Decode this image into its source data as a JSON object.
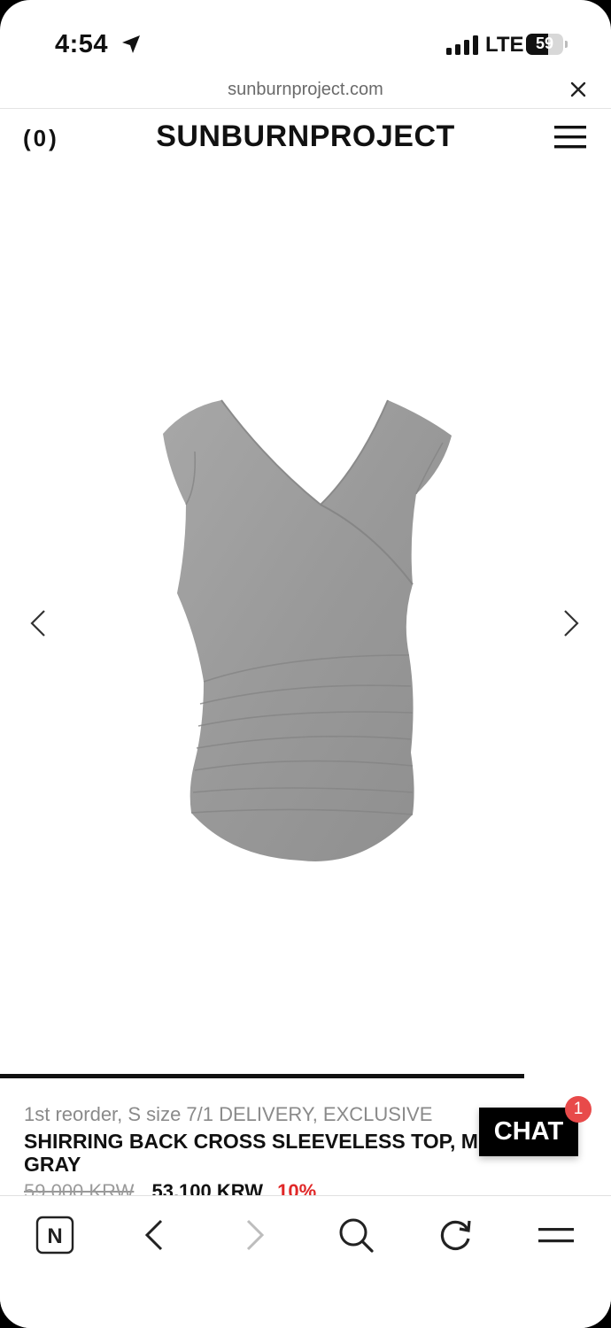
{
  "status_bar": {
    "time": "4:54",
    "network": "LTE",
    "battery_level": "59",
    "battery_fraction": 0.59,
    "icons": [
      "location-arrow-icon",
      "signal-bars-icon",
      "battery-icon"
    ]
  },
  "browser": {
    "url": "sunburnproject.com",
    "close_icon": "close-icon"
  },
  "header": {
    "cart_count": "(0)",
    "brand": "SUNBURNPROJECT",
    "menu_icon": "hamburger-menu-icon"
  },
  "product": {
    "image": "gray sleeveless shirred top",
    "prev_icon": "chevron-left-icon",
    "next_icon": "chevron-right-icon",
    "subtitle": "1st reorder, S size 7/1 DELIVERY, EXCLUSIVE",
    "title": "SHIRRING BACK CROSS SLEEVELESS TOP, M GRAY",
    "price_original": "59,000 KRW",
    "price_sale": "53,100 KRW",
    "discount": "10%",
    "colors": {
      "discount": "#e02828",
      "garment": "#9a9a9a"
    }
  },
  "chat": {
    "label": "CHAT",
    "badge": "1",
    "badge_color": "#e84a4a"
  },
  "toolbar": {
    "items": [
      {
        "icon": "naver-home-icon",
        "label": "N"
      },
      {
        "icon": "back-icon"
      },
      {
        "icon": "forward-icon"
      },
      {
        "icon": "search-icon"
      },
      {
        "icon": "refresh-icon"
      },
      {
        "icon": "tabs-menu-icon"
      }
    ]
  }
}
